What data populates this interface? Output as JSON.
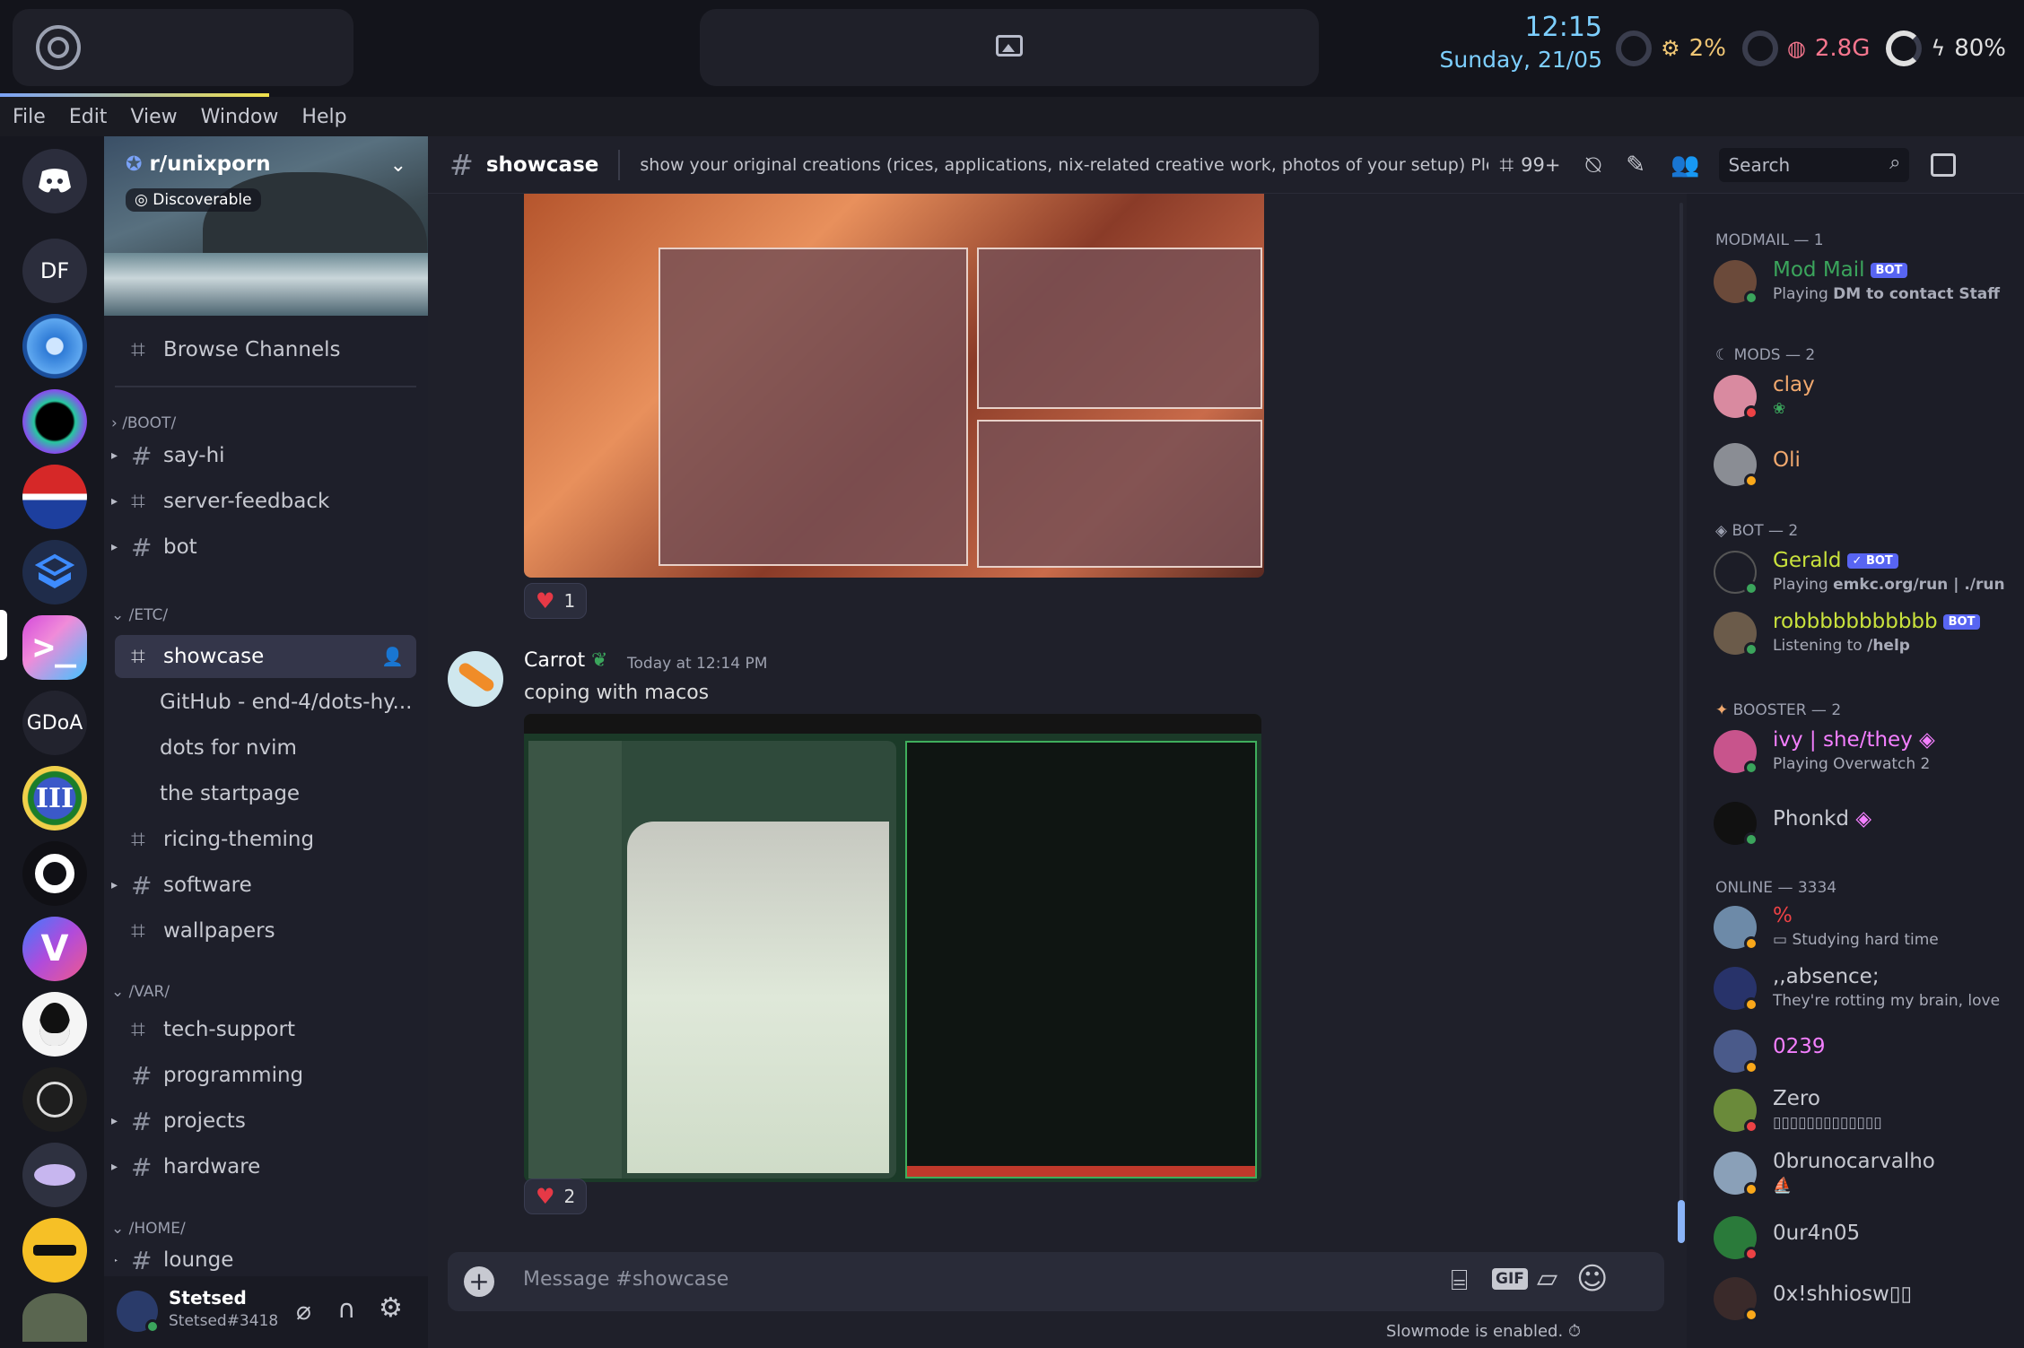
{
  "topbar": {
    "time": "12:15",
    "date": "Sunday, 21/05",
    "cpu": "2%",
    "ram": "2.8G",
    "battery": "80%"
  },
  "menu": [
    "File",
    "Edit",
    "View",
    "Window",
    "Help"
  ],
  "server": {
    "name": "r/unixporn",
    "badge": "Discoverable",
    "browse": "Browse Channels"
  },
  "guild_labels": {
    "df": "DF",
    "gdoa": "GDoA"
  },
  "categories": {
    "boot": "/BOOT/",
    "etc": "/ETC/",
    "var": "/VAR/",
    "home": "/HOME/"
  },
  "channels": {
    "say_hi": "say-hi",
    "server_feedback": "server-feedback",
    "bot": "bot",
    "showcase": "showcase",
    "thread1": "GitHub - end-4/dots-hy...",
    "thread2": "dots for nvim",
    "thread3": "the startpage",
    "ricing": "ricing-theming",
    "software": "software",
    "wallpapers": "wallpapers",
    "tech_support": "tech-support",
    "programming": "programming",
    "projects": "projects",
    "hardware": "hardware",
    "lounge": "lounge"
  },
  "user": {
    "name": "Stetsed",
    "tag": "Stetsed#3418"
  },
  "header": {
    "channel": "showcase",
    "topic": "show your original creations (rices, applications, nix-related creative work, photos of your setup) Please ...",
    "threads_count": "99+",
    "search_placeholder": "Search"
  },
  "messages": {
    "reaction1": "1",
    "author": "Carrot",
    "timestamp": "Today at 12:14 PM",
    "text": "coping with macos",
    "reaction2": "2"
  },
  "composer": {
    "placeholder": "Message #showcase",
    "gif": "GIF",
    "slowmode": "Slowmode is enabled."
  },
  "members": {
    "sections": {
      "modmail": "MODMAIL — 1",
      "mods": "MODS — 2",
      "bot": "BOT — 2",
      "booster": "BOOSTER — 2",
      "online": "ONLINE — 3334"
    },
    "bot_tag": "BOT",
    "list": [
      {
        "name": "Mod Mail",
        "sub_prefix": "Playing ",
        "sub_bold": "DM to contact Staff"
      },
      {
        "name": "clay",
        "sub": ""
      },
      {
        "name": "Oli",
        "sub": ""
      },
      {
        "name": "Gerald",
        "sub_prefix": "Playing ",
        "sub_bold": "emkc.org/run | ./run"
      },
      {
        "name": "robbbbbbbbbbb",
        "sub_prefix": "Listening to ",
        "sub_bold": "/help"
      },
      {
        "name": "ivy | she/they",
        "sub": "Playing Overwatch 2"
      },
      {
        "name": "Phonkd",
        "sub": ""
      },
      {
        "name": "%",
        "sub": "Studying hard time"
      },
      {
        "name": ",,absence;",
        "sub": "They're rotting my brain, love"
      },
      {
        "name": "0239",
        "sub": ""
      },
      {
        "name": "Zero",
        "sub": "▯▯▯▯▯▯▯▯▯▯▯▯▯"
      },
      {
        "name": "0brunocarvalho",
        "sub": ""
      },
      {
        "name": "0ur4n05",
        "sub": ""
      },
      {
        "name": "0x!shhiosw▯▯",
        "sub": ""
      }
    ]
  },
  "colors": {
    "accent": "#7dcfff",
    "blurple": "#5865f2",
    "online": "#3ba55c",
    "dnd": "#ed4245",
    "idle": "#faa81a"
  }
}
